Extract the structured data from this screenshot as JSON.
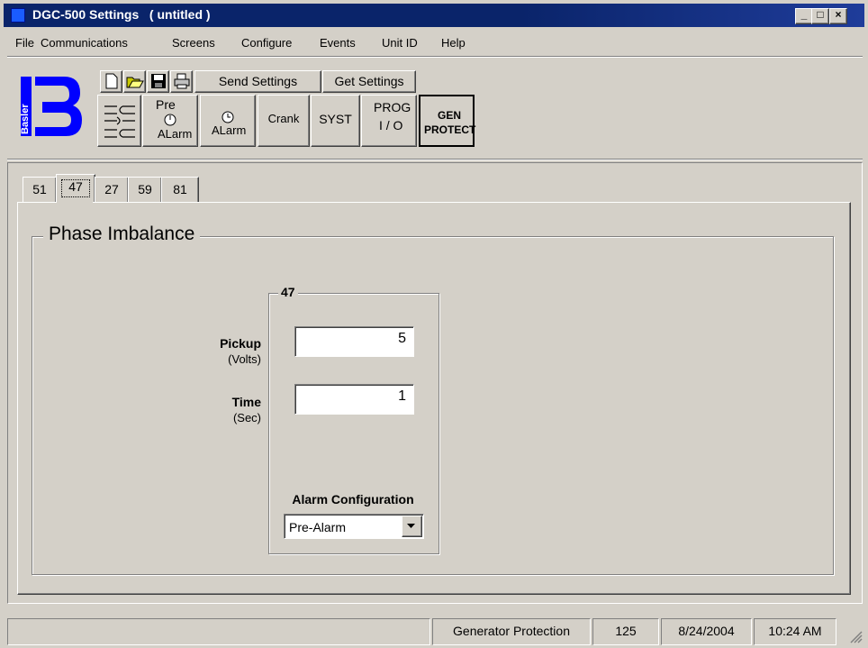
{
  "window": {
    "title": "DGC-500 Settings   ( untitled )",
    "controls": [
      "_",
      "□",
      "×"
    ]
  },
  "menu": [
    "File",
    "Communications",
    "Screens",
    "Configure",
    "Events",
    "Unit ID",
    "Help"
  ],
  "toolbar": {
    "logo_text": "Basler",
    "file_icons": [
      "new-file-icon",
      "open-folder-icon",
      "save-disk-icon",
      "print-icon"
    ],
    "send_settings": "Send Settings",
    "get_settings": "Get Settings",
    "screens": [
      {
        "name": "breaker-diagram",
        "label": ""
      },
      {
        "name": "pre-alarm",
        "label_top": "Pre",
        "label_bottom": "ALarm"
      },
      {
        "name": "alarm",
        "label_bottom": "ALarm"
      },
      {
        "name": "crank",
        "label": "Crank"
      },
      {
        "name": "syst",
        "label": "SYST"
      },
      {
        "name": "prog-io",
        "label_top": "PROG",
        "label_bottom": "I / O"
      },
      {
        "name": "gen-protect",
        "label_top": "GEN",
        "label_bottom": "PROTECT"
      }
    ]
  },
  "tabs": [
    "51",
    "47",
    "27",
    "59",
    "81"
  ],
  "active_tab": "47",
  "group": {
    "title": "Phase Imbalance",
    "inner_title": "47",
    "pickup_label": "Pickup",
    "pickup_unit": "(Volts)",
    "pickup_value": "5",
    "time_label": "Time",
    "time_unit": "(Sec)",
    "time_value": "1",
    "alarm_config_label": "Alarm Configuration",
    "alarm_config_value": "Pre-Alarm"
  },
  "status": {
    "section": "Generator Protection",
    "count": "125",
    "date": "8/24/2004",
    "time": "10:24 AM"
  },
  "colors": {
    "titlebar": "#0a246a",
    "face": "#d4d0c8",
    "logo_blue": "#0000ff"
  }
}
